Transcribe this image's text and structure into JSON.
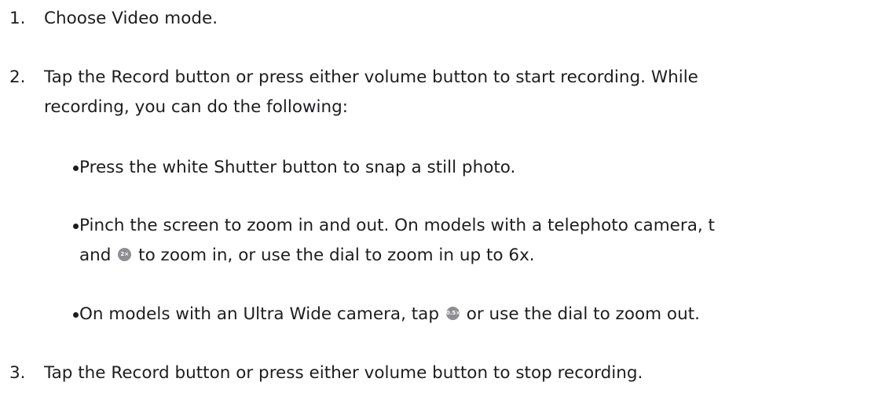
{
  "steps": [
    {
      "number": "1.",
      "text": "Choose Video mode."
    },
    {
      "number": "2.",
      "line1": "Tap the Record button or press either volume button to start recording. While",
      "line2": "recording, you can do the following:"
    },
    {
      "number": "3.",
      "text": "Tap the Record button or press either volume button to stop recording."
    }
  ],
  "bullets": {
    "b1": "Press the white Shutter button to snap a still photo.",
    "b2_line1": "Pinch the screen to zoom in and out. On models with a telephoto camera, t",
    "b2_line2_pre": "and",
    "b2_line2_post": "to zoom in, or use the dial to zoom in up to 6x.",
    "b3_pre": "On models with an Ultra Wide camera, tap",
    "b3_post": "or use the dial to zoom out."
  },
  "icons": {
    "zoom_2x": {
      "name": "zoom-2x-icon",
      "label": "2×"
    },
    "zoom_05x": {
      "name": "zoom-0.5x-icon",
      "label": "0.5×"
    }
  },
  "colors": {
    "text": "#1d1d1f",
    "icon_bg": "#8e8e93"
  }
}
